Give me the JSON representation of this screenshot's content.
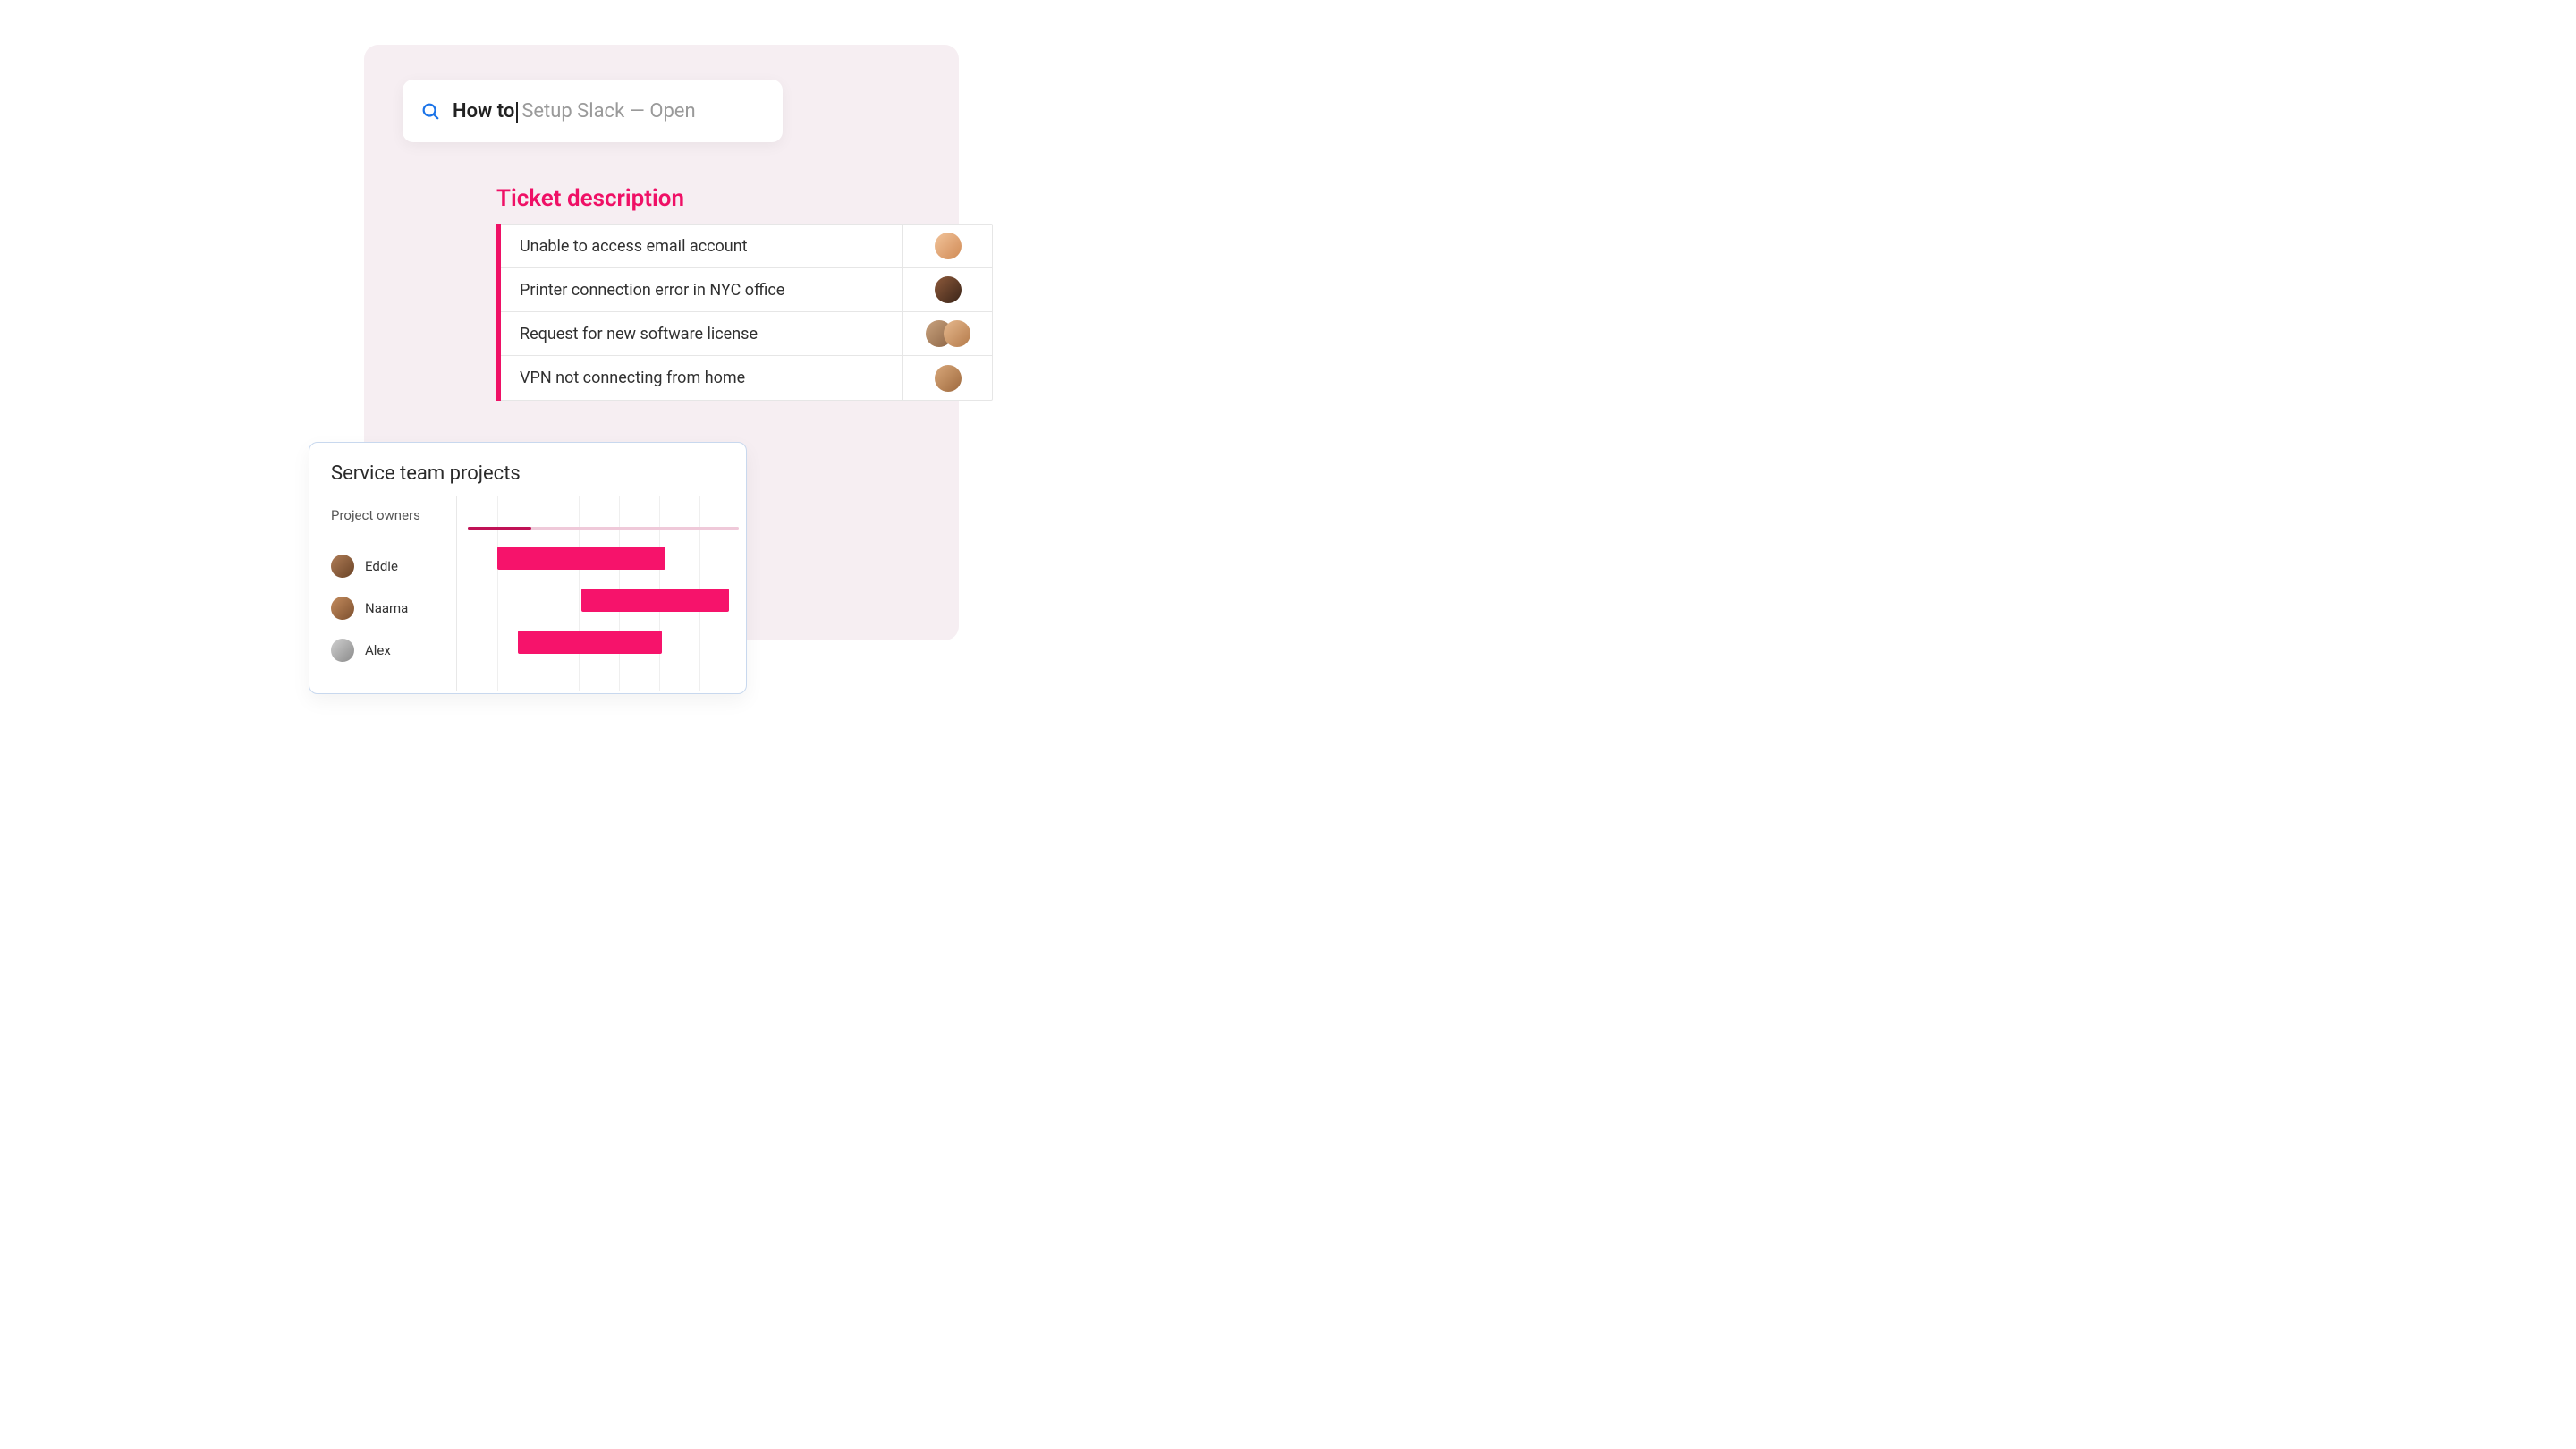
{
  "search": {
    "typed": "How to",
    "suggestion": "Setup Slack — Open"
  },
  "ticket_panel": {
    "title": "Ticket description",
    "rows": [
      {
        "label": "Unable to access email account"
      },
      {
        "label": "Printer connection error in NYC office"
      },
      {
        "label": "Request for new software license"
      },
      {
        "label": "VPN not connecting from home"
      }
    ]
  },
  "projects_card": {
    "title": "Service team projects",
    "owners_header": "Project owners",
    "owners": [
      {
        "name": "Eddie"
      },
      {
        "name": "Naama"
      },
      {
        "name": "Alex"
      }
    ],
    "gridlines_pct": [
      14,
      28,
      42,
      56,
      70,
      84
    ],
    "timeline_progress_pct": 22,
    "bars": [
      {
        "row": 0,
        "left_pct": 14,
        "width_pct": 58
      },
      {
        "row": 1,
        "left_pct": 43,
        "width_pct": 51
      },
      {
        "row": 2,
        "left_pct": 21,
        "width_pct": 50
      }
    ]
  },
  "colors": {
    "accent": "#ef1066",
    "search_icon": "#1a73e8"
  }
}
